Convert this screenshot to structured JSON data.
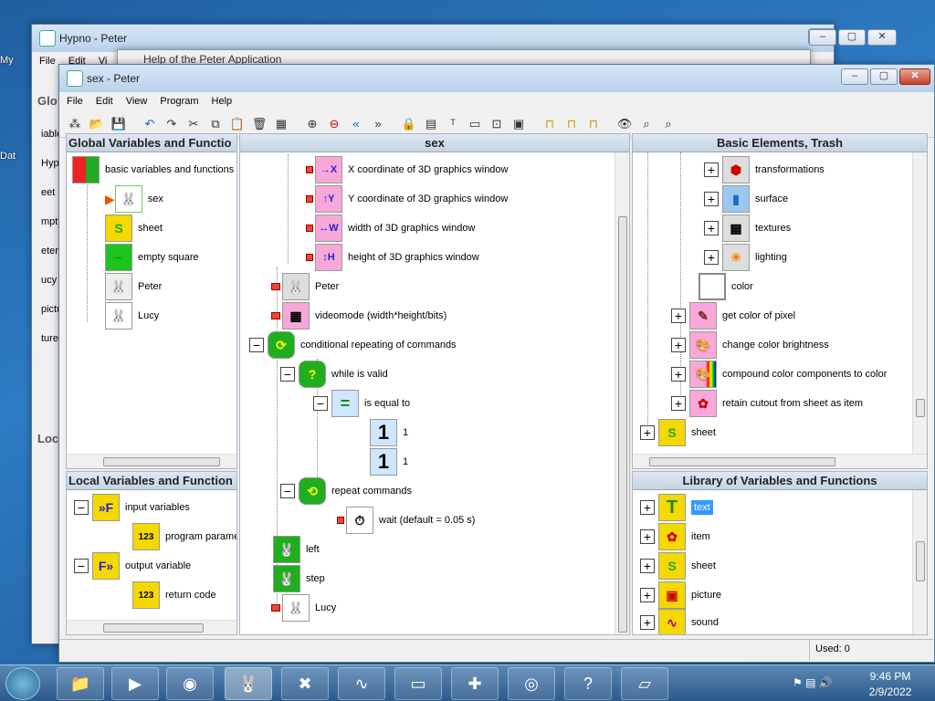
{
  "desktop": {
    "icons": [
      "My",
      "Dat",
      "iable",
      "Hyp",
      "eet",
      "mpty",
      "eter",
      "ucy",
      "pictu",
      "tures"
    ]
  },
  "back_window": {
    "title": "Hypno - Peter",
    "menu": [
      "File",
      "Edit",
      "Vi"
    ],
    "help_window_title": "Help of the Peter Application",
    "panel_labels": [
      "Glo",
      "Loc"
    ]
  },
  "main_window": {
    "title": "sex - Peter",
    "menu": [
      "File",
      "Edit",
      "View",
      "Program",
      "Help"
    ]
  },
  "global_pane": {
    "title": "Global Variables and Functio",
    "items": [
      {
        "label": "basic variables and functions",
        "icon": "grid-color-icon"
      },
      {
        "label": "sex",
        "icon": "rabbit-selected-icon"
      },
      {
        "label": "sheet",
        "icon": "sheet-icon"
      },
      {
        "label": "empty square",
        "icon": "empty-square-icon"
      },
      {
        "label": "Peter",
        "icon": "rabbit-peter-icon"
      },
      {
        "label": "Lucy",
        "icon": "rabbit-lucy-icon"
      }
    ]
  },
  "local_pane": {
    "title": "Local Variables and Function",
    "items": [
      {
        "label": "input variables",
        "icon": "input-f-icon"
      },
      {
        "label": "program parame",
        "icon": "param-icon"
      },
      {
        "label": "output variable",
        "icon": "output-f-icon"
      },
      {
        "label": "return code",
        "icon": "return-code-icon"
      }
    ]
  },
  "center_pane": {
    "title": "sex",
    "items": [
      {
        "label": "X coordinate of 3D graphics window",
        "sym": "→X"
      },
      {
        "label": "Y coordinate of 3D graphics window",
        "sym": "↑Y"
      },
      {
        "label": "width of 3D graphics window",
        "sym": "↔W"
      },
      {
        "label": "height of 3D graphics window",
        "sym": "↕H"
      },
      {
        "label": "Peter",
        "sym": "🐰"
      },
      {
        "label": "videomode (width*height/bits)",
        "sym": "▦"
      },
      {
        "label": "conditional repeating of commands",
        "sym": "⟳"
      },
      {
        "label": "while is valid",
        "sym": "?"
      },
      {
        "label": "is equal to",
        "sym": "="
      },
      {
        "label": "1",
        "sym": "1"
      },
      {
        "label": "1",
        "sym": "1"
      },
      {
        "label": "repeat commands",
        "sym": "⟲"
      },
      {
        "label": "wait (default = 0.05 s)",
        "sym": "⏱"
      },
      {
        "label": "left",
        "sym": "🐰"
      },
      {
        "label": "step",
        "sym": "🐰"
      },
      {
        "label": "Lucy",
        "sym": "🐰"
      }
    ]
  },
  "basic_pane": {
    "title": "Basic Elements, Trash",
    "items": [
      {
        "label": "transformations",
        "sym": "⬢"
      },
      {
        "label": "surface",
        "sym": "▮"
      },
      {
        "label": "textures",
        "sym": "▩"
      },
      {
        "label": "lighting",
        "sym": "☀"
      },
      {
        "label": "color",
        "sym": ""
      },
      {
        "label": "get color of pixel",
        "sym": "✎"
      },
      {
        "label": "change color brightness",
        "sym": "🎨"
      },
      {
        "label": "compound color components to color",
        "sym": "🎨"
      },
      {
        "label": "retain cutout from sheet as item",
        "sym": "✿"
      },
      {
        "label": "sheet",
        "sym": "S"
      }
    ]
  },
  "library_pane": {
    "title": "Library of Variables and Functions",
    "items": [
      {
        "label": "text",
        "sym": "T"
      },
      {
        "label": "item",
        "sym": "✿"
      },
      {
        "label": "sheet",
        "sym": "S"
      },
      {
        "label": "picture",
        "sym": "▣"
      },
      {
        "label": "sound",
        "sym": "∿"
      }
    ]
  },
  "status_bar": {
    "used": "Used: 0"
  },
  "taskbar": {
    "time": "9:46 PM",
    "date": "2/9/2022"
  },
  "colors": {
    "accent": "#3399ff",
    "icon_yellow": "#f5d800",
    "icon_pink": "#f7a8d8"
  }
}
